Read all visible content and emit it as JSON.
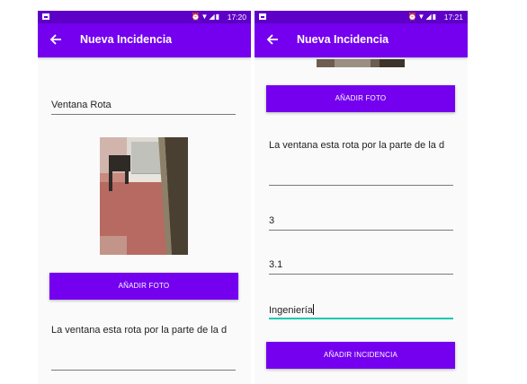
{
  "left_screen": {
    "status_time": "17:20",
    "title": "Nueva Incidencia",
    "title_value": "Ventana Rota",
    "add_photo_label": "AÑADIR FOTO",
    "description_value": "La ventana esta rota por la parte de la d"
  },
  "right_screen": {
    "status_time": "17:21",
    "title": "Nueva Incidencia",
    "add_photo_label": "AÑADIR FOTO",
    "description_value": "La ventana esta rota por la parte de la d",
    "field_3_value": "3",
    "field_4_value": "3.1",
    "field_5_value": "Ingeniería",
    "add_incident_label": "AÑADIR INCIDENCIA"
  },
  "icons": [
    "photo-icon",
    "alarm-icon",
    "wifi-icon",
    "signal-icon",
    "battery-icon",
    "back-arrow-icon"
  ],
  "colors": {
    "status_bar": "#5e00c8",
    "app_bar": "#7400ef",
    "button": "#7400ef",
    "focus_underline": "#11c9b2"
  }
}
